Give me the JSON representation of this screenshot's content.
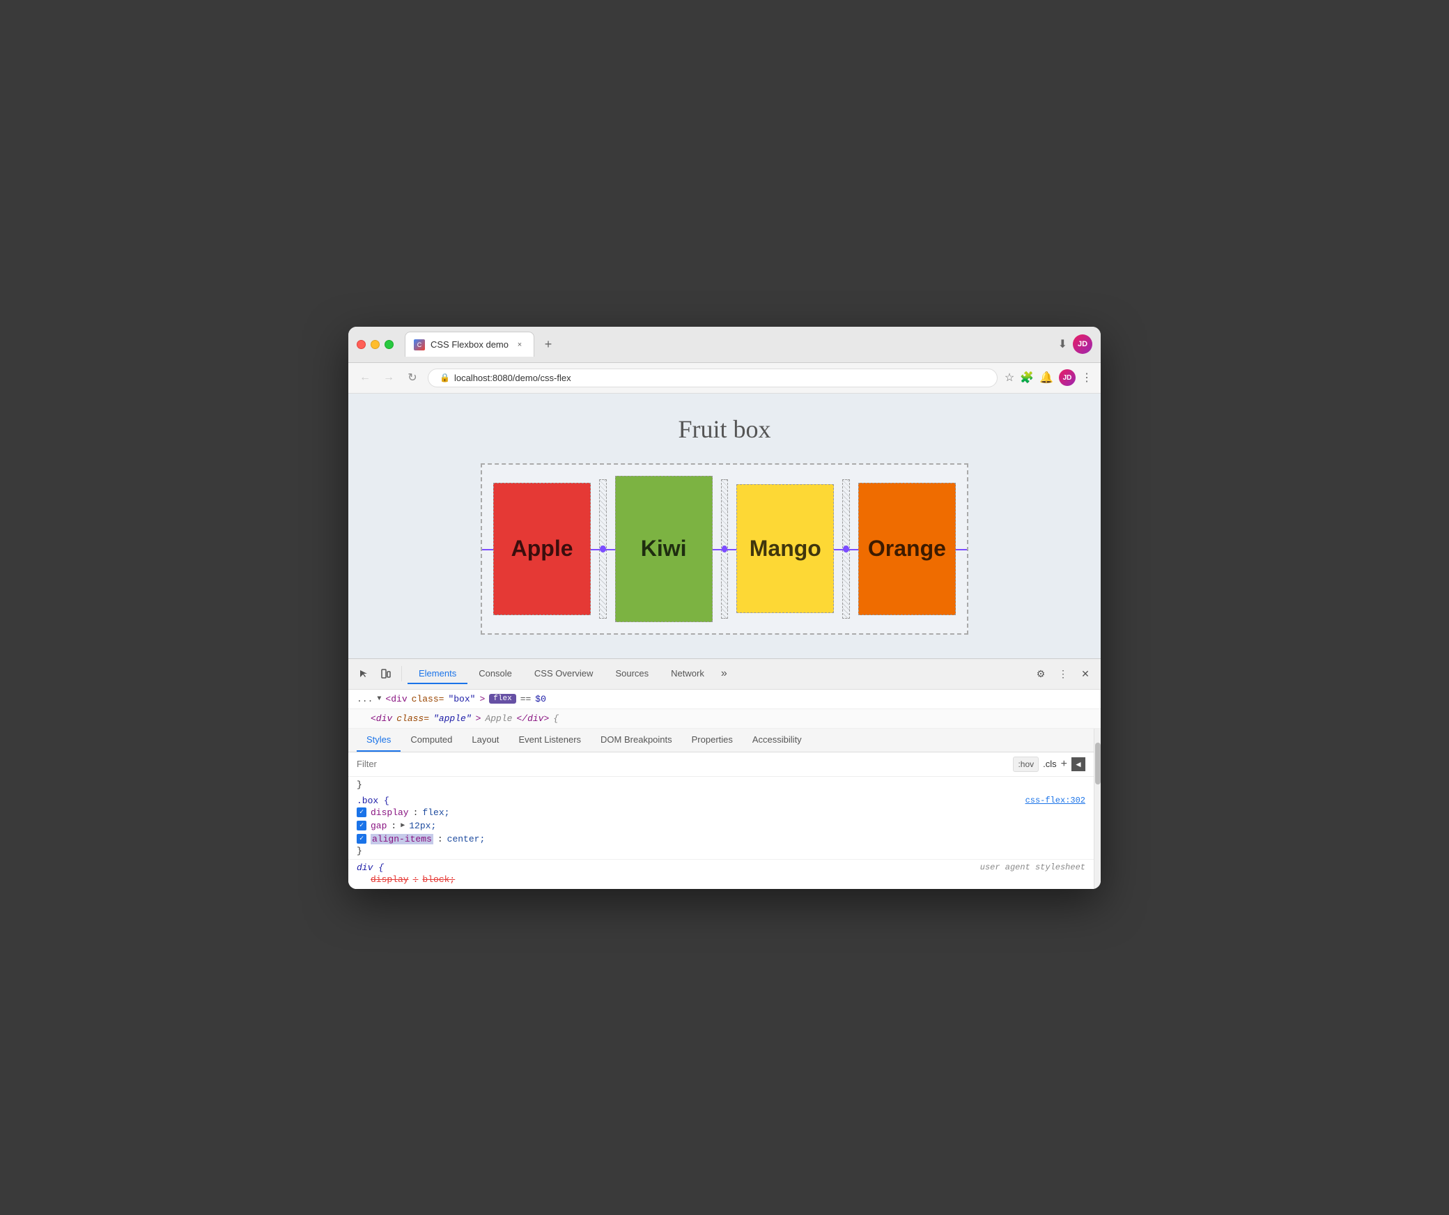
{
  "browser": {
    "tab_title": "CSS Flexbox demo",
    "tab_close": "×",
    "new_tab": "+",
    "address": "localhost:8080/demo/css-flex",
    "address_prefix": "localhost",
    "address_suffix": ":8080/demo/css-flex",
    "nav_back": "←",
    "nav_forward": "→",
    "nav_refresh": "↻",
    "download_icon": "⬇"
  },
  "page": {
    "title": "Fruit box",
    "fruits": [
      {
        "name": "Apple",
        "color": "#e53935"
      },
      {
        "name": "Kiwi",
        "color": "#7cb342"
      },
      {
        "name": "Mango",
        "color": "#fdd835"
      },
      {
        "name": "Orange",
        "color": "#ef6c00"
      }
    ]
  },
  "devtools": {
    "tabs": [
      {
        "label": "Elements",
        "active": true
      },
      {
        "label": "Console",
        "active": false
      },
      {
        "label": "CSS Overview",
        "active": false
      },
      {
        "label": "Sources",
        "active": false
      },
      {
        "label": "Network",
        "active": false
      }
    ],
    "more_btn": "»",
    "dom_line1": "...",
    "dom_arrow": "▼",
    "dom_tag": "div",
    "dom_attr": "class",
    "dom_attr_value": "\"box\"",
    "dom_badge": "flex",
    "dom_equals": "==",
    "dom_var": "$0",
    "dom_line2_tag": "div",
    "dom_line2_attr": "class",
    "dom_line2_val": "\"apple\"",
    "styles_tabs": [
      "Styles",
      "Computed",
      "Layout",
      "Event Listeners",
      "DOM Breakpoints",
      "Properties",
      "Accessibility"
    ],
    "filter_placeholder": "Filter",
    "filter_hov": ":hov",
    "filter_cls": ".cls",
    "filter_plus": "+",
    "css_rule1_selector": ".box {",
    "css_rule1_source": "css-flex:302",
    "css_rule1_props": [
      {
        "enabled": true,
        "name": "display",
        "value": "flex;"
      },
      {
        "enabled": true,
        "name": "gap",
        "value": "12px;",
        "has_triangle": true
      },
      {
        "enabled": true,
        "name": "align-items",
        "value": "center;",
        "highlighted": true
      }
    ],
    "css_rule2_selector": "div {",
    "css_rule2_source": "user agent stylesheet",
    "css_rule2_props": [
      {
        "enabled": true,
        "name": "display",
        "value": "block;",
        "strikethrough": true
      }
    ]
  }
}
